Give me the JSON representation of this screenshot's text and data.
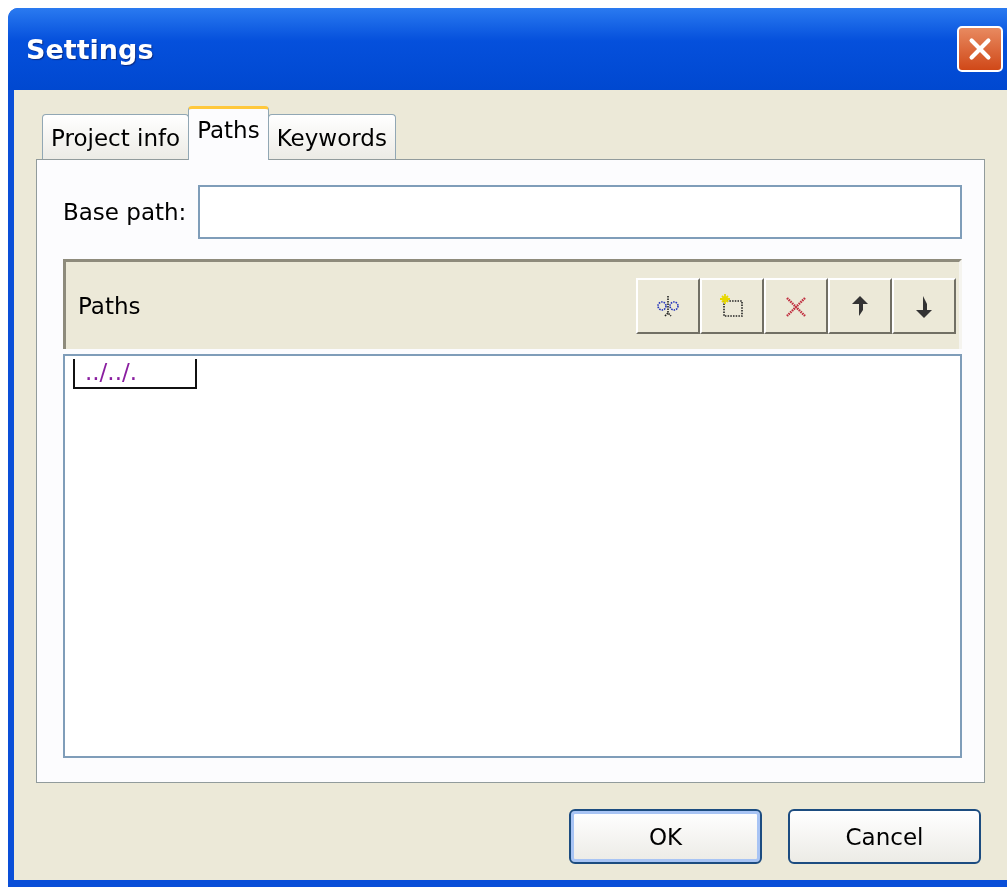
{
  "window": {
    "title": "Settings"
  },
  "tabs": [
    {
      "label": "Project info",
      "selected": false
    },
    {
      "label": "Paths",
      "selected": true
    },
    {
      "label": "Keywords",
      "selected": false
    }
  ],
  "base_path": {
    "label": "Base path:"
  },
  "paths_group": {
    "title": "Paths",
    "toolbar": [
      {
        "kind": "rename"
      },
      {
        "kind": "new"
      },
      {
        "kind": "delete"
      },
      {
        "kind": "up"
      },
      {
        "kind": "down"
      }
    ],
    "items": [
      {
        "text": "../../.",
        "editing": true
      }
    ]
  },
  "buttons": [
    {
      "label": "OK",
      "default": true
    },
    {
      "label": "Cancel",
      "default": false
    }
  ]
}
